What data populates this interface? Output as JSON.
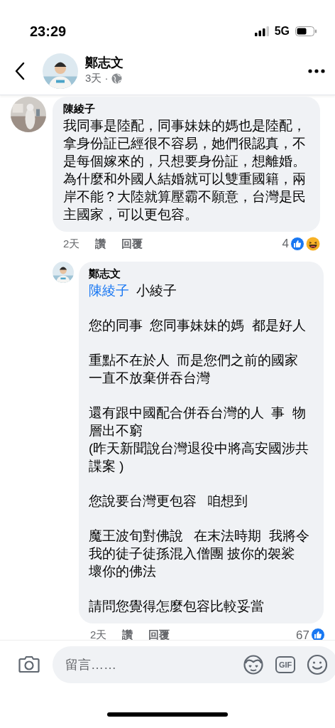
{
  "status_bar": {
    "time": "23:29",
    "network": "5G"
  },
  "header": {
    "author": "鄭志文",
    "meta": "3天 ·"
  },
  "comment": {
    "author": "陳綾子",
    "lines": [
      "我同事是陸配，同事妹妹的媽也是陸配，",
      "拿身份証已經很不容易，她們很認真，不",
      "是每個嫁來的，只想要身份証，想離婚。",
      "為什麼和外國人結婚就可以雙重國籍，兩",
      "岸不能？大陸就算壓霸不願意，台灣是民",
      "主國家，可以更包容。"
    ],
    "time": "2天",
    "actions": [
      "讚",
      "回覆"
    ],
    "reaction_count": "4",
    "reactions": [
      {
        "kind": "like"
      },
      {
        "kind": "haha"
      }
    ]
  },
  "reply": {
    "author": "鄭志文",
    "mention": "陳綾子",
    "mention_suffix": "小綾子",
    "paragraphs": [
      [
        "您的同事  您同事妹妹的媽  都是好人"
      ],
      [
        "重點不在於人  而是您們之前的國家",
        "一直不放棄併吞台灣"
      ],
      [
        "還有跟中國配合併吞台灣的人  事  物",
        "層出不窮",
        "(昨天新聞說台灣退役中將高安國涉共",
        "諜案 )"
      ],
      [
        "您說要台灣更包容   咱想到"
      ],
      [
        "魔王波旬對佛說   在末法時期  我將令",
        "我的徒子徒孫混入僧團 披你的袈裟",
        "壞你的佛法"
      ],
      [
        "請問您覺得怎麼包容比較妥當"
      ]
    ],
    "time": "2天",
    "actions": [
      "讚",
      "回覆"
    ],
    "reaction_count": "67",
    "reactions": [
      {
        "kind": "like"
      }
    ]
  },
  "composer": {
    "placeholder": "留言……",
    "gif_label": "GIF"
  }
}
